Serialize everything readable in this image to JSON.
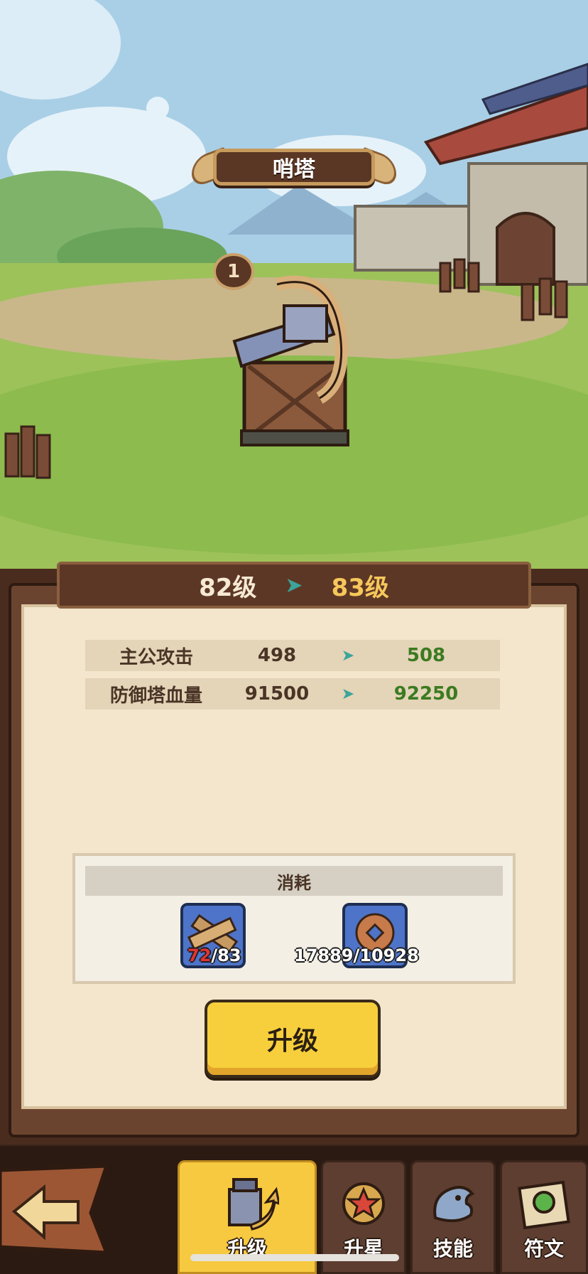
{
  "building": {
    "name": "哨塔",
    "level_badge": "1"
  },
  "level": {
    "current": "82级",
    "next": "83级"
  },
  "stats": [
    {
      "label": "主公攻击",
      "current": "498",
      "next": "508"
    },
    {
      "label": "防御塔血量",
      "current": "91500",
      "next": "92250"
    }
  ],
  "cost": {
    "title": "消耗",
    "items": [
      {
        "icon": "wood-planks-icon",
        "have": "72",
        "need": "83",
        "insufficient": true
      },
      {
        "icon": "copper-coin-icon",
        "have": "17889",
        "need": "10928",
        "insufficient": false
      }
    ]
  },
  "upgrade_button": "升级",
  "tabs": [
    {
      "label": "升级",
      "icon": "tower-upgrade-icon",
      "active": true
    },
    {
      "label": "升星",
      "icon": "star-medal-icon",
      "active": false
    },
    {
      "label": "技能",
      "icon": "dragon-skill-icon",
      "active": false
    },
    {
      "label": "符文",
      "icon": "rune-scroll-icon",
      "active": false
    }
  ],
  "colors": {
    "accent_yellow": "#f7cf3c",
    "stat_increase": "#3b7b21",
    "insufficient": "#e03434",
    "arrow_teal": "#3aa59a"
  }
}
